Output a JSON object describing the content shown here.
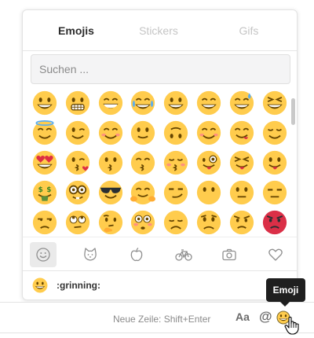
{
  "picker": {
    "tabs": [
      {
        "label": "Emojis",
        "active": true
      },
      {
        "label": "Stickers",
        "active": false
      },
      {
        "label": "Gifs",
        "active": false
      }
    ],
    "search_placeholder": "Suchen ...",
    "emojis": [
      [
        "grinning",
        "grimacing",
        "grin",
        "joy",
        "smiley",
        "smile",
        "sweat_smile",
        "laughing"
      ],
      [
        "innocent",
        "wink",
        "blush",
        "slightly_smiling",
        "upside_down",
        "relaxed",
        "yum",
        "relieved"
      ],
      [
        "heart_eyes",
        "kissing_heart",
        "kissing",
        "kissing_smiling_eyes",
        "kissing_closed_eyes",
        "zany",
        "stuck_out_tongue_closed_eyes",
        "stuck_out_tongue"
      ],
      [
        "money_mouth",
        "nerd",
        "sunglasses",
        "hugging",
        "smirk",
        "no_mouth",
        "neutral",
        "expressionless"
      ],
      [
        "unamused",
        "rolling_eyes",
        "thinking",
        "flushed",
        "disappointed",
        "worried",
        "angry",
        "rage"
      ]
    ],
    "categories": [
      {
        "name": "smiley-icon",
        "active": true
      },
      {
        "name": "cat-icon",
        "active": false
      },
      {
        "name": "apple-icon",
        "active": false
      },
      {
        "name": "bicycle-icon",
        "active": false
      },
      {
        "name": "camera-icon",
        "active": false
      },
      {
        "name": "heart-icon",
        "active": false
      }
    ],
    "preview_name": ":grinning:"
  },
  "composer": {
    "hint": "Neue Zeile: Shift+Enter",
    "format_label": "Aa",
    "mention_label": "@"
  },
  "tooltip": {
    "label": "Emoji"
  },
  "colors": {
    "emoji_yellow": "#FFCC4D",
    "emoji_dark": "#664500",
    "angry_red": "#DA2F47",
    "tongue": "#DD2E44",
    "cheek": "#FF7892"
  }
}
